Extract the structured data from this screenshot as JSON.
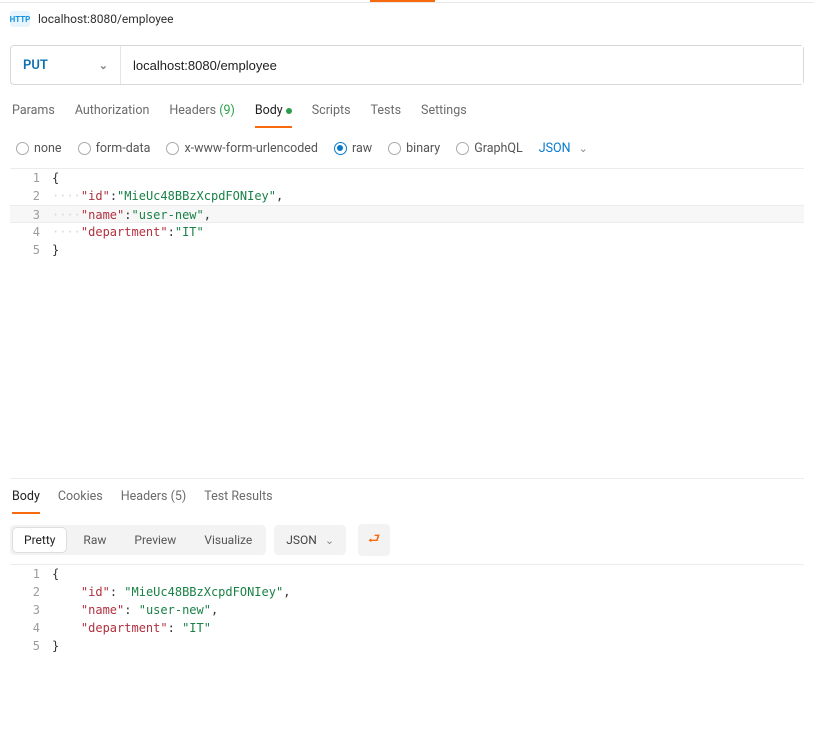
{
  "header": {
    "badge_text": "HTTP",
    "title": "localhost:8080/employee"
  },
  "request": {
    "method": "PUT",
    "url": "localhost:8080/employee"
  },
  "request_tabs": {
    "params": "Params",
    "authorization": "Authorization",
    "headers_label": "Headers",
    "headers_count": "(9)",
    "body": "Body",
    "scripts": "Scripts",
    "tests": "Tests",
    "settings": "Settings"
  },
  "body_type_options": {
    "none": "none",
    "form_data": "form-data",
    "x_www": "x-www-form-urlencoded",
    "raw": "raw",
    "binary": "binary",
    "graphql": "GraphQL"
  },
  "body_format": "JSON",
  "request_body": {
    "line1": "{",
    "line2_key": "\"id\"",
    "line2_val": "\"MieUc48BBzXcpdFONIey\"",
    "line3_key": "\"name\"",
    "line3_val": "\"user-new\"",
    "line4_key": "\"department\"",
    "line4_val": "\"IT\"",
    "line5": "}"
  },
  "response_tabs": {
    "body": "Body",
    "cookies": "Cookies",
    "headers_label": "Headers",
    "headers_count": "(5)",
    "test_results": "Test Results"
  },
  "response_views": {
    "pretty": "Pretty",
    "raw": "Raw",
    "preview": "Preview",
    "visualize": "Visualize"
  },
  "response_format": "JSON",
  "response_body": {
    "line1": "{",
    "line2_key": "\"id\"",
    "line2_val": "\"MieUc48BBzXcpdFONIey\"",
    "line3_key": "\"name\"",
    "line3_val": "\"user-new\"",
    "line4_key": "\"department\"",
    "line4_val": "\"IT\"",
    "line5": "}"
  }
}
